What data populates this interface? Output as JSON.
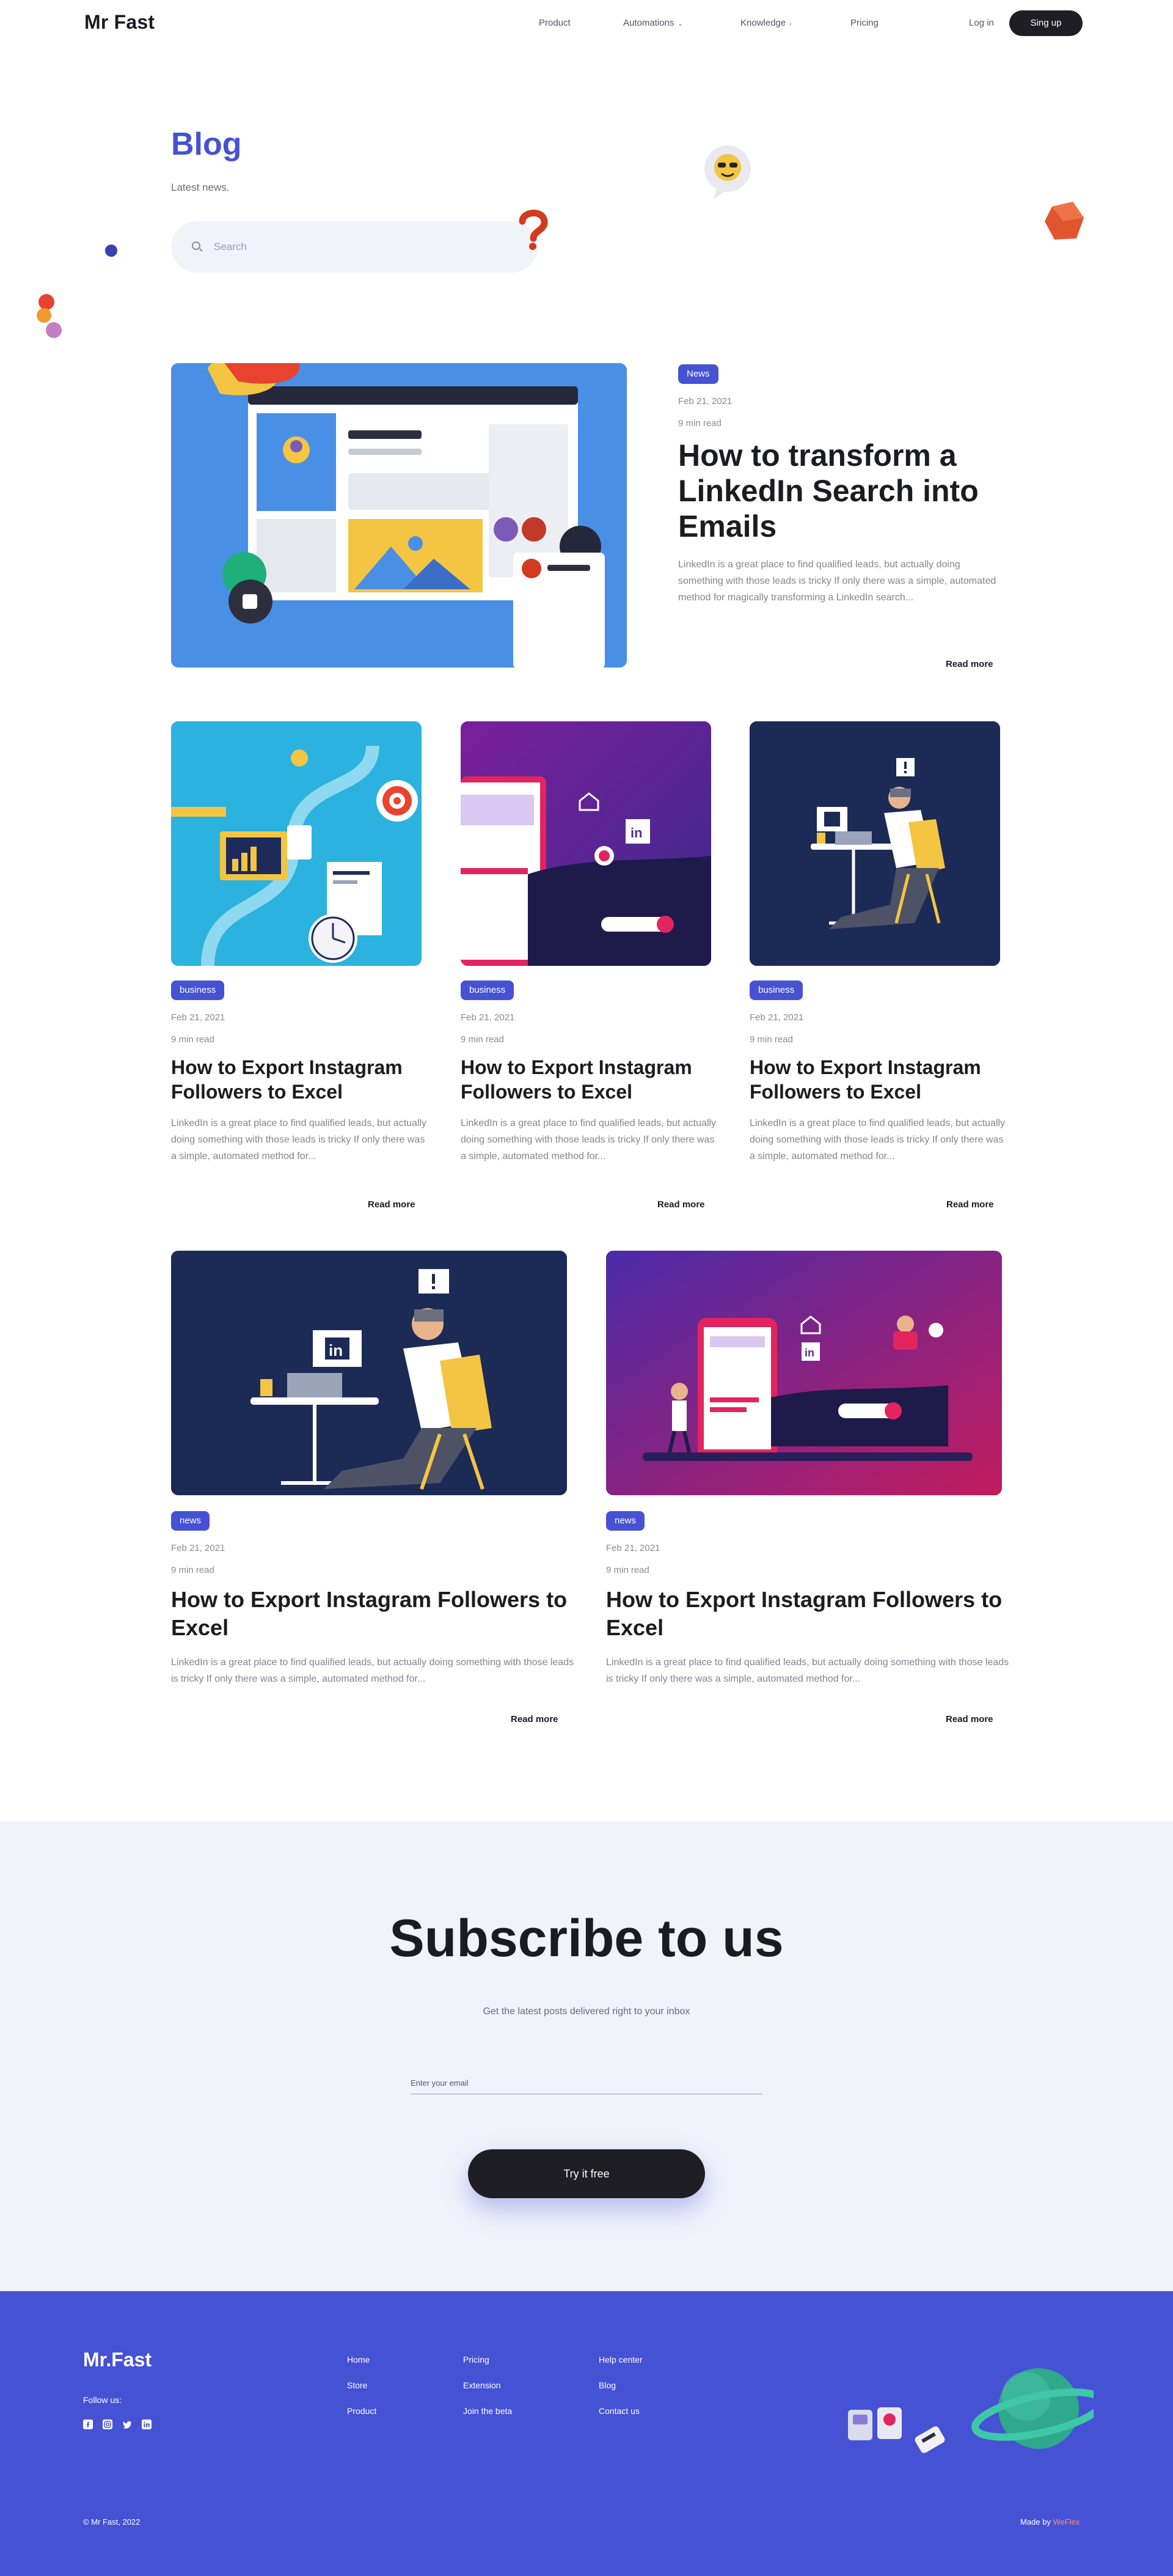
{
  "nav": {
    "logo": "Mr Fast",
    "items": [
      {
        "label": "Product",
        "chev": ""
      },
      {
        "label": "Automations",
        "chev": "⌄"
      },
      {
        "label": "Knowledge",
        "chev": "›"
      },
      {
        "label": "Pricing",
        "chev": ""
      }
    ],
    "login": "Log in",
    "signup": "Sing up"
  },
  "hero": {
    "title": "Blog",
    "subtitle": "Latest news.",
    "search_placeholder": "Search"
  },
  "featured": {
    "tag": "News",
    "date": "Feb 21, 2021",
    "read_time": "9 min read",
    "title": "How to transform a LinkedIn Search into Emails",
    "excerpt": "LinkedIn is a great place to find qualified leads, but actually doing something with those leads is tricky If only there was a simple, automated method for magically transforming a LinkedIn search...",
    "read_more": "Read more"
  },
  "row1": [
    {
      "tag": "business",
      "date": "Feb 21, 2021",
      "read_time": "9 min read",
      "title": "How to Export Instagram Followers to Excel",
      "excerpt": "LinkedIn is a great place to find qualified leads, but actually doing something with those leads is tricky If only there was a simple, automated method for...",
      "read_more": "Read more"
    },
    {
      "tag": "business",
      "date": "Feb 21, 2021",
      "read_time": "9 min read",
      "title": "How to Export Instagram Followers to Excel",
      "excerpt": "LinkedIn is a great place to find qualified leads, but actually doing something with those leads is tricky If only there was a simple, automated method for...",
      "read_more": "Read more"
    },
    {
      "tag": "business",
      "date": "Feb 21, 2021",
      "read_time": "9 min read",
      "title": "How to Export Instagram Followers to Excel",
      "excerpt": "LinkedIn is a great place to find qualified leads, but actually doing something with those leads is tricky If only there was a simple, automated method for...",
      "read_more": "Read more"
    }
  ],
  "row2": [
    {
      "tag": "news",
      "date": "Feb 21, 2021",
      "read_time": "9 min read",
      "title": "How to Export Instagram Followers to Excel",
      "excerpt": "LinkedIn is a great place to find qualified leads, but actually doing something with those leads is tricky If only there was a simple, automated method for...",
      "read_more": "Read more"
    },
    {
      "tag": "news",
      "date": "Feb 21, 2021",
      "read_time": "9 min read",
      "title": "How to Export Instagram Followers to Excel",
      "excerpt": "LinkedIn is a great place to find qualified leads, but actually doing something with those leads is tricky If only there was a simple, automated method for...",
      "read_more": "Read more"
    }
  ],
  "subscribe": {
    "title": "Subscribe to us",
    "text": "Get the latest posts delivered right to your inbox",
    "email_placeholder": "Enter your email",
    "button": "Try it free"
  },
  "footer": {
    "logo": "Mr.Fast",
    "follow": "Follow us:",
    "social_icons": [
      "facebook-icon",
      "instagram-icon",
      "twitter-icon",
      "linkedin-icon"
    ],
    "col1": [
      "Home",
      "Store",
      "Product"
    ],
    "col2": [
      "Pricing",
      "Extension",
      "Join the beta"
    ],
    "col3": [
      "Help center",
      "Blog",
      "Contact us"
    ],
    "copyright": "© Mr Fast, 2022",
    "made_by": "Made by",
    "made_by_link": "WeFlex"
  },
  "colors": {
    "accent": "#4652d4",
    "dark": "#1e1e24",
    "muted_bg": "#f1f3fb"
  }
}
